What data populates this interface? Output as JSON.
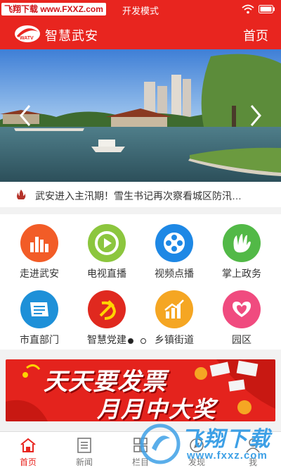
{
  "status_bar": {
    "watermark": "飞翔下载 www.FXXZ.com",
    "mode": "开发模式"
  },
  "header": {
    "app_title": "智慧武安",
    "home_label": "首页",
    "logo_icon": "station-logo-icon"
  },
  "banner": {
    "prev_icon": "chevron-left-icon",
    "next_icon": "chevron-right-icon"
  },
  "ticker": {
    "icon": "flame-icon",
    "text": "武安进入主汛期！雪生书记再次察看城区防汛…"
  },
  "grid": {
    "items": [
      {
        "label": "走进武安",
        "icon": "bar-chart-icon",
        "color": "#f25c27"
      },
      {
        "label": "电视直播",
        "icon": "play-icon",
        "color": "#8cc63e"
      },
      {
        "label": "视频点播",
        "icon": "film-reel-icon",
        "color": "#1e88e5"
      },
      {
        "label": "掌上政务",
        "icon": "hand-icon",
        "color": "#52b947"
      },
      {
        "label": "市直部门",
        "icon": "document-icon",
        "color": "#1e90d8"
      },
      {
        "label": "智慧党建",
        "icon": "hammer-sickle-icon",
        "color": "#e0291f"
      },
      {
        "label": "乡镇街道",
        "icon": "rising-chart-icon",
        "color": "#f5a623"
      },
      {
        "label": "园区",
        "icon": "hearts-icon",
        "color": "#f04b7f"
      }
    ],
    "page_index": 0,
    "page_count": 2
  },
  "ad": {
    "line1": "天天要发票",
    "line2": "月月中大奖"
  },
  "bottom_nav": {
    "tabs": [
      {
        "label": "首页",
        "icon": "home-icon"
      },
      {
        "label": "新闻",
        "icon": "news-icon"
      },
      {
        "label": "栏目",
        "icon": "grid-icon"
      },
      {
        "label": "发现",
        "icon": "discover-icon"
      },
      {
        "label": "我",
        "icon": "user-icon"
      }
    ],
    "active": 0
  },
  "overlay_watermark": {
    "title": "飞翔下载",
    "sub": "www.fxxz.com"
  },
  "colors": {
    "brand_red": "#e8251f",
    "watermark_blue": "#3da0e6"
  }
}
